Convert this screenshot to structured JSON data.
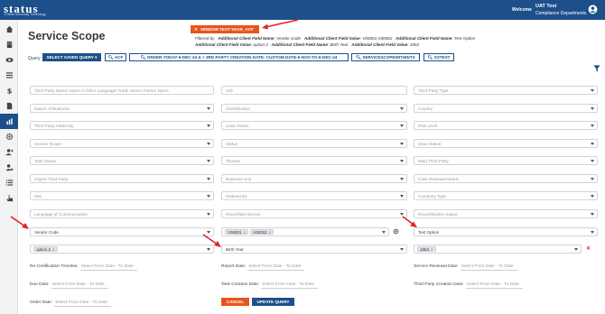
{
  "header": {
    "logo": "status",
    "logo_sub": "A Wise University Technology",
    "welcome": "Welcome",
    "user_name": "UAT Test",
    "user_dept": "Compliance Departments"
  },
  "sidebar": {
    "items": [
      {
        "icon": "home-icon"
      },
      {
        "icon": "building-icon"
      },
      {
        "icon": "eye-icon"
      },
      {
        "icon": "list-icon"
      },
      {
        "icon": "dollar-icon"
      },
      {
        "icon": "document-icon"
      },
      {
        "icon": "bar-chart-icon",
        "active": true
      },
      {
        "icon": "gear-icon"
      },
      {
        "icon": "user-plus-icon"
      },
      {
        "icon": "user-gear-icon"
      },
      {
        "icon": "list-check-icon"
      },
      {
        "icon": "hand-pointer-icon"
      }
    ]
  },
  "page_title": "Service Scope",
  "active_filter": {
    "chip_label": "VENDOR-TEST-YEAR_ACF",
    "line1": {
      "filtered_by": "Filtered by",
      "f1_label": "Additional Client Field Name",
      "f1_value": "Vendor Code",
      "f2_label": "Additional Client Field Value",
      "f2_value": "V00001,V00002",
      "f3_label": "Additional Client Field Name",
      "f3_value": "Test Option"
    },
    "line2": {
      "f1_label": "Additional Client Field Value",
      "f1_value": "option 2",
      "f2_label": "Additional Client Field Name",
      "f2_value": "Birth Year",
      "f3_label": "Additional Client Field Value",
      "f3_value": "1963"
    }
  },
  "query_bar": {
    "label": "Query",
    "saved_query": "SELECT SAVED QUERY",
    "btn_acf": "ACF",
    "btn_order": "ORDER-TODAY-6-DEC-24 & > 3RD PARTY CREATION DATE- CUSTOM-DATE-6-NOV-TO-6-DEC-24",
    "btn_scope": "SERVICESCOPEWITHINTS",
    "btn_sstest": "SSTEST"
  },
  "fields": {
    "r1": [
      "Third Party Name/ Name in Other Language/ Trade Name/ Former Name",
      "UID",
      "Third Party Type"
    ],
    "r2": [
      "Nature of Business",
      "Classification",
      "Country"
    ],
    "r3": [
      "Third Party Added By",
      "Case Owner",
      "Risk Level"
    ],
    "r4": [
      "Service Scope",
      "Status",
      "Issue Status"
    ],
    "r5": [
      "Task Status",
      "Theatre",
      "Main Third Party"
    ],
    "r6": [
      "Urgent Third Party",
      "Business Unit",
      "Case Reviewal Status"
    ],
    "r7": [
      "Hits",
      "Ordered By",
      "Company Type"
    ],
    "r8": [
      "Language of Communication",
      "Recertified Service",
      "Recertification Status"
    ],
    "r9": [
      "Vendor Code",
      "",
      "Test Option"
    ],
    "r10": [
      "",
      "Birth Year",
      ""
    ]
  },
  "tags": {
    "vendor_values": [
      "V00001",
      "V00002"
    ],
    "test_option_value": "option 2",
    "birth_year_value": "1963",
    "tag_close": "×"
  },
  "dates": {
    "placeholder": "Select From Date - To Date",
    "recert": "Re-Certification Timeline:",
    "report": "Report Date:",
    "service_reviewal": "Service Reviewal Date:",
    "due": "Due Date:",
    "task_creation": "Task Creation Date:",
    "third_party_creation": "Third Party Creation Date:",
    "order": "Order Date:"
  },
  "actions": {
    "cancel": "CANCEL",
    "update": "UPDATE QUERY"
  },
  "colors": {
    "brand": "#1d4f8a",
    "accent": "#e8541d",
    "arrow": "#e02424"
  }
}
